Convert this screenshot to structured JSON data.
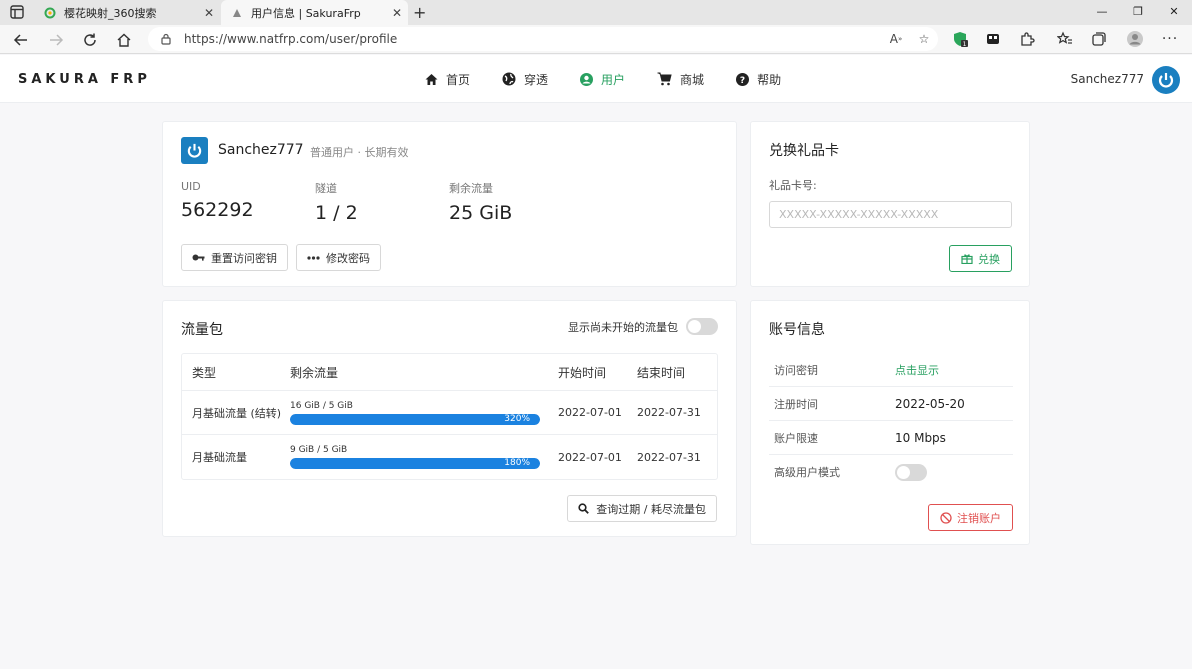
{
  "browser": {
    "tabs": [
      {
        "title": "樱花映射_360搜索"
      },
      {
        "title": "用户信息 | SakuraFrp"
      }
    ],
    "url": "https://www.natfrp.com/user/profile",
    "extension_badge": "1"
  },
  "site": {
    "logo": "SAKURA FRP",
    "nav": [
      {
        "label": "首页",
        "icon": "home-icon"
      },
      {
        "label": "穿透",
        "icon": "globe-icon"
      },
      {
        "label": "用户",
        "icon": "user-circle-icon"
      },
      {
        "label": "商城",
        "icon": "cart-icon"
      },
      {
        "label": "帮助",
        "icon": "help-icon"
      }
    ],
    "username": "Sanchez777"
  },
  "profile": {
    "name": "Sanchez777",
    "type": "普通用户 · 长期有效",
    "stats": [
      {
        "label": "UID",
        "value": "562292"
      },
      {
        "label": "隧道",
        "value": "1 / 2"
      },
      {
        "label": "剩余流量",
        "value": "25 GiB"
      }
    ],
    "reset_key_label": "重置访问密钥",
    "change_password_label": "修改密码"
  },
  "gift": {
    "title": "兑换礼品卡",
    "label": "礼品卡号:",
    "placeholder": "XXXXX-XXXXX-XXXXX-XXXXX",
    "redeem_label": "兑换"
  },
  "traffic": {
    "title": "流量包",
    "toggle_label": "显示尚未开始的流量包",
    "columns": [
      "类型",
      "剩余流量",
      "开始时间",
      "结束时间"
    ],
    "rows": [
      {
        "type": "月基础流量 (结转)",
        "remaining": "16 GiB / 5 GiB",
        "percent_label": "320%",
        "fill_fraction": 1.0,
        "start": "2022-07-01",
        "end": "2022-07-31"
      },
      {
        "type": "月基础流量",
        "remaining": "9 GiB / 5 GiB",
        "percent_label": "180%",
        "fill_fraction": 1.0,
        "start": "2022-07-01",
        "end": "2022-07-31"
      }
    ],
    "query_label": "查询过期 / 耗尽流量包"
  },
  "account": {
    "title": "账号信息",
    "rows": [
      {
        "key": "访问密钥",
        "value": "点击显示"
      },
      {
        "key": "注册时间",
        "value": "2022-05-20"
      },
      {
        "key": "账户限速",
        "value": "10 Mbps"
      },
      {
        "key": "高级用户模式",
        "value": ""
      }
    ],
    "advanced_mode_on": false,
    "delete_label": "注销账户"
  },
  "colors": {
    "accent": "#28a060",
    "brand": "#1a7fc0",
    "progress": "#1b82e0",
    "danger": "#e05050"
  }
}
